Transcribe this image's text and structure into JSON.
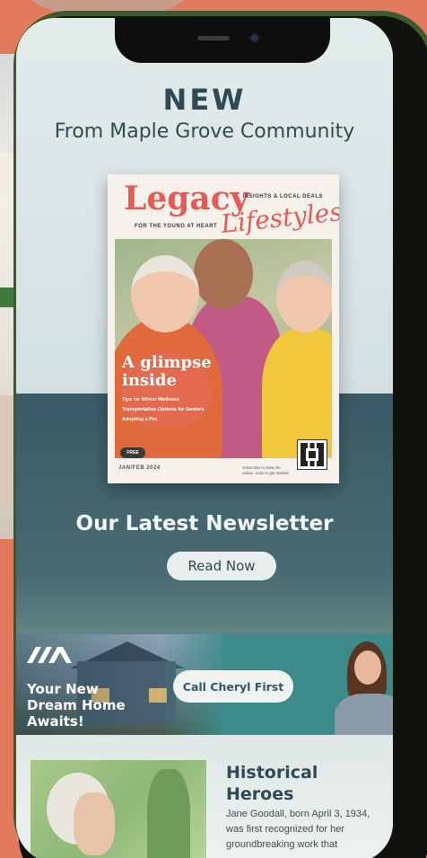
{
  "hero": {
    "new_label": "NEW",
    "from_label": "From Maple Grove Community"
  },
  "cover": {
    "title_main": "Legacy",
    "title_script": "Lifestyles",
    "insights_label": "INSIGHTS & LOCAL DEALS",
    "tagline": "FOR THE YOUNG AT HEART",
    "glimpse_line1": "A glimpse",
    "glimpse_line2": "inside",
    "bullets": [
      "Tips for Winter Wellness",
      "Transportation Options for Seniors",
      "Adopting a Pet"
    ],
    "free_badge": "FREE",
    "date": "JAN/FEB 2024",
    "subscribe": "Subscribe to view me online, scan to get started"
  },
  "newsletter": {
    "heading": "Our Latest Newsletter",
    "read_now_label": "Read Now"
  },
  "banner": {
    "dream_line1": "Your New",
    "dream_line2": "Dream Home",
    "dream_line3": "Awaits!",
    "call_label": "Call Cheryl First"
  },
  "article": {
    "title_line1": "Historical",
    "title_line2": "Heroes",
    "body": "Jane Goodall, born April 3, 1934, was first recognized for her groundbreaking work that"
  },
  "colors": {
    "accent_teal": "#2e4a55",
    "cover_red": "#e35b55",
    "phone_frame": "#3d5a2c",
    "background": "#e27a5e"
  }
}
